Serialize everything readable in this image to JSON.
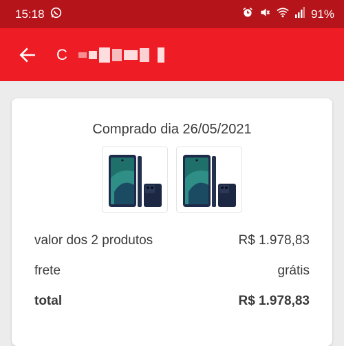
{
  "status_bar": {
    "time": "15:18",
    "battery": "91%"
  },
  "header": {
    "title_initial": "C"
  },
  "order": {
    "purchase_date": "Comprado dia 26/05/2021",
    "products": [
      {
        "image": "phone-product-image"
      },
      {
        "image": "phone-product-image"
      }
    ],
    "summary": {
      "items_label": "valor dos 2 produtos",
      "items_value": "R$ 1.978,83",
      "shipping_label": "frete",
      "shipping_value": "grátis",
      "total_label": "total",
      "total_value": "R$ 1.978,83"
    }
  },
  "colors": {
    "status_bar": "#b4141a",
    "app_bar": "#ee1c25",
    "background": "#ececec"
  }
}
